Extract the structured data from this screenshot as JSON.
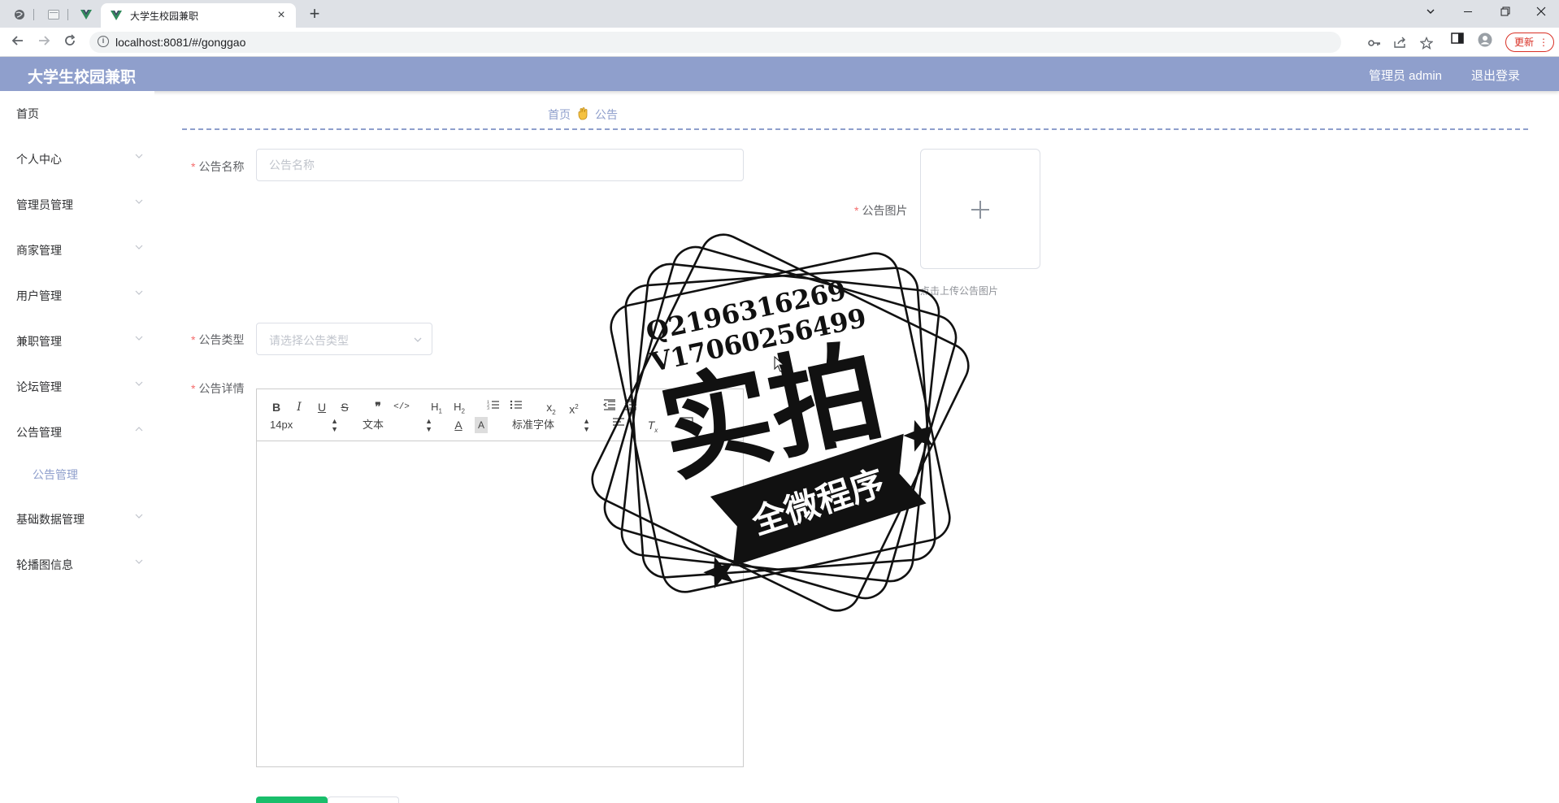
{
  "browser": {
    "active_tab_title": "大学生校园兼职",
    "url": "localhost:8081/#/gonggao",
    "update_label": "更新"
  },
  "header": {
    "brand": "大学生校园兼职",
    "user_label": "管理员 admin",
    "logout_label": "退出登录",
    "accent_color": "#8f9fcc"
  },
  "sidebar": {
    "items": [
      {
        "label": "首页"
      },
      {
        "label": "个人中心"
      },
      {
        "label": "管理员管理"
      },
      {
        "label": "商家管理"
      },
      {
        "label": "用户管理"
      },
      {
        "label": "兼职管理"
      },
      {
        "label": "论坛管理"
      },
      {
        "label": "公告管理"
      },
      {
        "label": "基础数据管理"
      },
      {
        "label": "轮播图信息"
      }
    ],
    "open_submenu": {
      "label": "公告管理"
    }
  },
  "breadcrumb": {
    "home": "首页",
    "current": "公告"
  },
  "form": {
    "name_label": "公告名称",
    "name_placeholder": "公告名称",
    "image_label": "公告图片",
    "upload_tip": "点击上传公告图片",
    "type_label": "公告类型",
    "type_placeholder": "请选择公告类型",
    "detail_label": "公告详情"
  },
  "editor": {
    "font_size": "14px",
    "header_picker": "文本",
    "font_picker": "标准字体"
  },
  "watermark": {
    "line1": "Q2196316269",
    "line2": "V17060256499",
    "big_text": "实拍",
    "ribbon_text": "全微程序"
  }
}
